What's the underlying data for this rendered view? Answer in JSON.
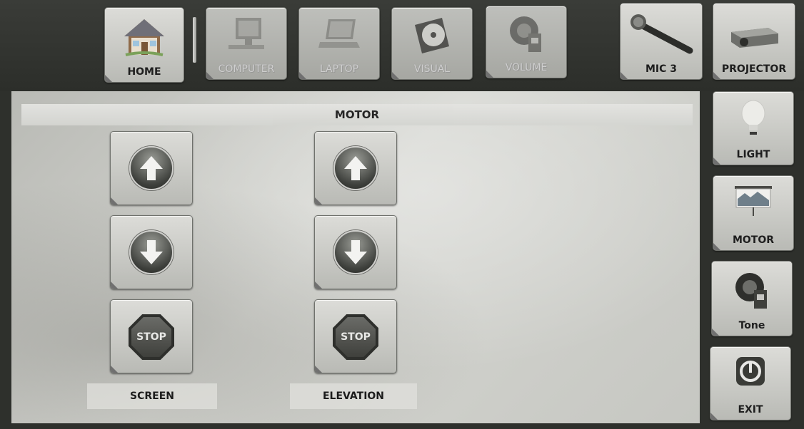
{
  "top_nav": {
    "home": "HOME",
    "computer": "COMPUTER",
    "laptop": "LAPTOP",
    "visual": "VISUAL",
    "volume": "VOLUME",
    "mic": "MIC 3",
    "projector": "PROJECTOR"
  },
  "side_nav": {
    "light": "LIGHT",
    "motor": "MOTOR",
    "tone": "Tone",
    "exit": "EXIT"
  },
  "panel": {
    "title": "MOTOR",
    "stop_text": "STOP",
    "columns": [
      {
        "label": "SCREEN"
      },
      {
        "label": "ELEVATION"
      }
    ]
  }
}
